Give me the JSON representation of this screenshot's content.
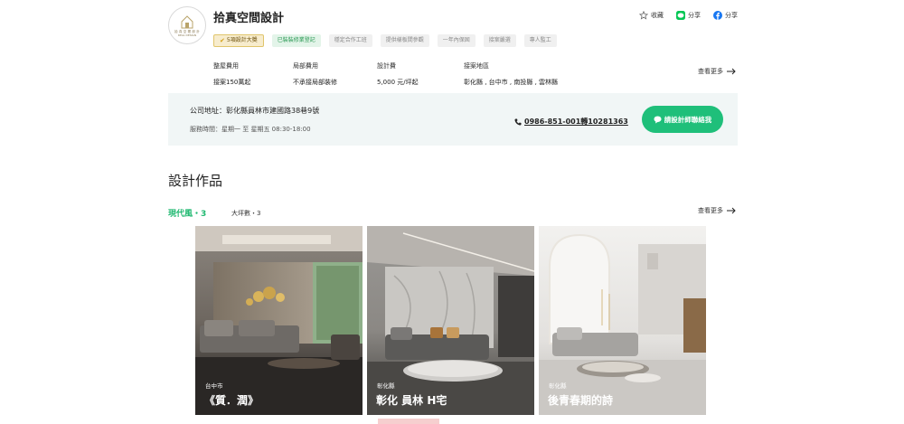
{
  "header": {
    "company_name": "拾真空間設計",
    "logo_caption": "拾 真 空 間 設 計",
    "logo_caption_en": "REAL DESIGN"
  },
  "actions": [
    {
      "label": "收藏",
      "icon": "star-icon"
    },
    {
      "label": "分享",
      "icon": "line-icon"
    },
    {
      "label": "分享",
      "icon": "facebook-icon"
    }
  ],
  "tags": [
    {
      "label": "5項設計大獎",
      "kind": "award"
    },
    {
      "label": "已裝裝修業登記",
      "kind": "registered"
    },
    {
      "label": "穩定合作工班",
      "kind": "plain"
    },
    {
      "label": "提供樣板間參觀",
      "kind": "plain"
    },
    {
      "label": "一年內保固",
      "kind": "plain"
    },
    {
      "label": "接案嚴選",
      "kind": "plain"
    },
    {
      "label": "專人監工",
      "kind": "plain"
    }
  ],
  "info": {
    "full_label": "整屋費用",
    "full_value": "接案150萬起",
    "partial_label": "局部費用",
    "partial_value": "不承接局部裝修",
    "design_label": "設計費",
    "design_value": "5,000 元/坪起",
    "area_label": "接案地區",
    "area_value": "彰化縣 , 台中市 , 南投縣 , 雲林縣",
    "see_more": "查看更多"
  },
  "contact": {
    "address": "公司地址：彰化縣員林市建國路38巷9號",
    "hours": "服務時間：星期一 至 星期五 08:30-18:00",
    "phone": "0986-851-001轉10281363",
    "cta_label": "請設計師聯絡我"
  },
  "portfolio": {
    "section_title": "設計作品",
    "tab_active": "現代風・3",
    "tab_other": "大坪數・3",
    "see_more": "查看更多",
    "cards": [
      {
        "location": "台中市",
        "title": "《質．潤》"
      },
      {
        "location": "彰化縣",
        "title": "彰化 員林 H宅"
      },
      {
        "location": "彰化縣",
        "title": "後青春期的詩"
      }
    ]
  },
  "colors": {
    "accent_green": "#1fbf7a",
    "award_gold": "#d4a017",
    "contact_bg": "#f1f6f6"
  }
}
